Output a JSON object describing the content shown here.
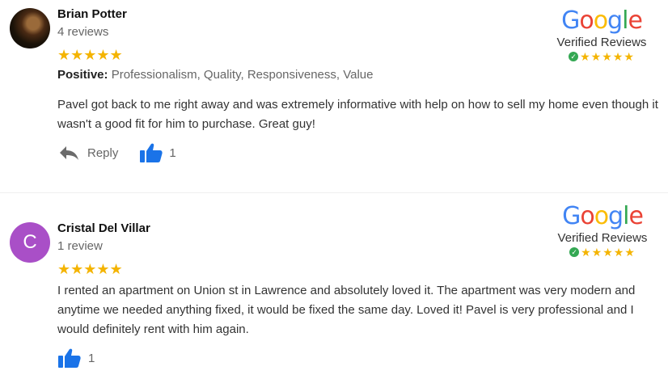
{
  "badge": {
    "logo_letters": [
      {
        "char": "G",
        "color": "#4285F4"
      },
      {
        "char": "o",
        "color": "#EA4335"
      },
      {
        "char": "o",
        "color": "#FBBC05"
      },
      {
        "char": "g",
        "color": "#4285F4"
      },
      {
        "char": "l",
        "color": "#34A853"
      },
      {
        "char": "e",
        "color": "#EA4335"
      }
    ],
    "subtitle": "Verified Reviews",
    "stars": "★★★★★",
    "check": "✓"
  },
  "reviews": [
    {
      "name": "Brian Potter",
      "review_count": "4 reviews",
      "stars": "★★★★★",
      "rating": 5,
      "positive_label": "Positive:",
      "positive_values": "Professionalism, Quality, Responsiveness, Value",
      "text": "Pavel got back to me right away and was extremely informative with help on how to sell my home even though it wasn't a good fit for him to purchase. Great guy!",
      "reply_label": "Reply",
      "like_count": "1"
    },
    {
      "name": "Cristal Del Villar",
      "avatar_letter": "C",
      "review_count": "1 review",
      "stars": "★★★★★",
      "rating": 5,
      "text": "I rented an apartment on Union st in Lawrence and absolutely loved it. The apartment was very modern and anytime we needed anything fixed, it would be fixed the same day. Loved it! Pavel is very professional and I would definitely rent with him again.",
      "like_count": "1"
    }
  ],
  "colors": {
    "star": "#f4b400",
    "thumb": "#1a73e8",
    "avatar_c": "#a94fc7",
    "verified_check": "#34a853"
  }
}
